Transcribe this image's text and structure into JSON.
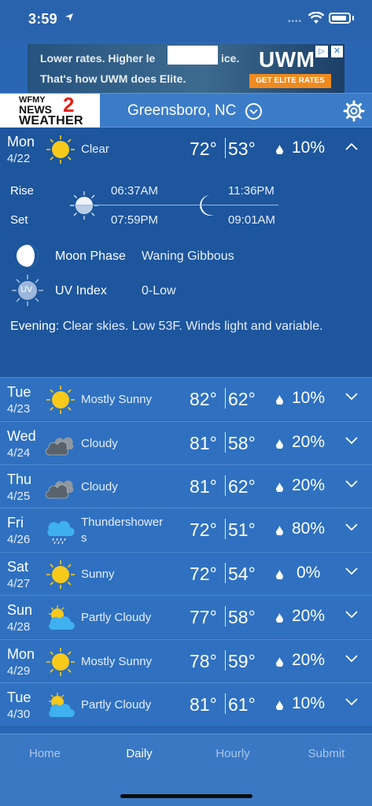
{
  "status_bar": {
    "time": "3:59"
  },
  "ad": {
    "line1": "Lower rates. Higher le",
    "line1_tail": "ice.",
    "line2": "That's how UWM does Elite.",
    "brand": "UWM",
    "cta": "GET ELITE RATES",
    "close": "✕",
    "adchoices": "▷"
  },
  "header": {
    "logo_top": "WFMY",
    "logo_news": "NEWS",
    "logo_number": "2",
    "logo_weather": "WEATHER",
    "city": "Greensboro, NC"
  },
  "today": {
    "dow": "Mon",
    "date": "4/22",
    "condition": "Clear",
    "icon": "sun-icon",
    "high": "72°",
    "low": "53°",
    "precip": "10%",
    "sun": {
      "rise_label": "Rise",
      "set_label": "Set",
      "rise": "06:37AM",
      "set": "07:59PM"
    },
    "moon": {
      "rise": "11:36PM",
      "set": "09:01AM"
    },
    "moon_phase_label": "Moon Phase",
    "moon_phase": "Waning Gibbous",
    "uv_label": "UV Index",
    "uv_icon_text": "UV",
    "uv_value": "0-Low",
    "summary_label": "Evening",
    "summary_text": ": Clear skies. Low 53F. Winds light and variable."
  },
  "days": [
    {
      "dow": "Tue",
      "date": "4/23",
      "condition": "Mostly Sunny",
      "icon": "sun-icon",
      "high": "82°",
      "low": "62°",
      "precip": "10%"
    },
    {
      "dow": "Wed",
      "date": "4/24",
      "condition": "Cloudy",
      "icon": "cloudy-icon",
      "high": "81°",
      "low": "58°",
      "precip": "20%"
    },
    {
      "dow": "Thu",
      "date": "4/25",
      "condition": "Cloudy",
      "icon": "cloudy-icon",
      "high": "81°",
      "low": "62°",
      "precip": "20%"
    },
    {
      "dow": "Fri",
      "date": "4/26",
      "condition": "Thundershower",
      "condition2": "s",
      "icon": "rain-cloud-icon",
      "high": "72°",
      "low": "51°",
      "precip": "80%"
    },
    {
      "dow": "Sat",
      "date": "4/27",
      "condition": "Sunny",
      "icon": "sun-icon",
      "high": "72°",
      "low": "54°",
      "precip": "0%"
    },
    {
      "dow": "Sun",
      "date": "4/28",
      "condition": "Partly Cloudy",
      "icon": "partly-cloudy-icon",
      "high": "77°",
      "low": "58°",
      "precip": "20%"
    },
    {
      "dow": "Mon",
      "date": "4/29",
      "condition": "Mostly Sunny",
      "icon": "sun-icon",
      "high": "78°",
      "low": "59°",
      "precip": "20%"
    },
    {
      "dow": "Tue",
      "date": "4/30",
      "condition": "Partly Cloudy",
      "icon": "partly-cloudy-icon",
      "high": "81°",
      "low": "61°",
      "precip": "10%"
    }
  ],
  "tabs": [
    {
      "label": "Home",
      "active": false
    },
    {
      "label": "Daily",
      "active": true
    },
    {
      "label": "Hourly",
      "active": false
    },
    {
      "label": "Submit",
      "active": false
    }
  ],
  "colors": {
    "background": "#2a66b3",
    "expanded": "#1d569d",
    "row": "#2f71c0",
    "sun": "#f7c91b"
  }
}
